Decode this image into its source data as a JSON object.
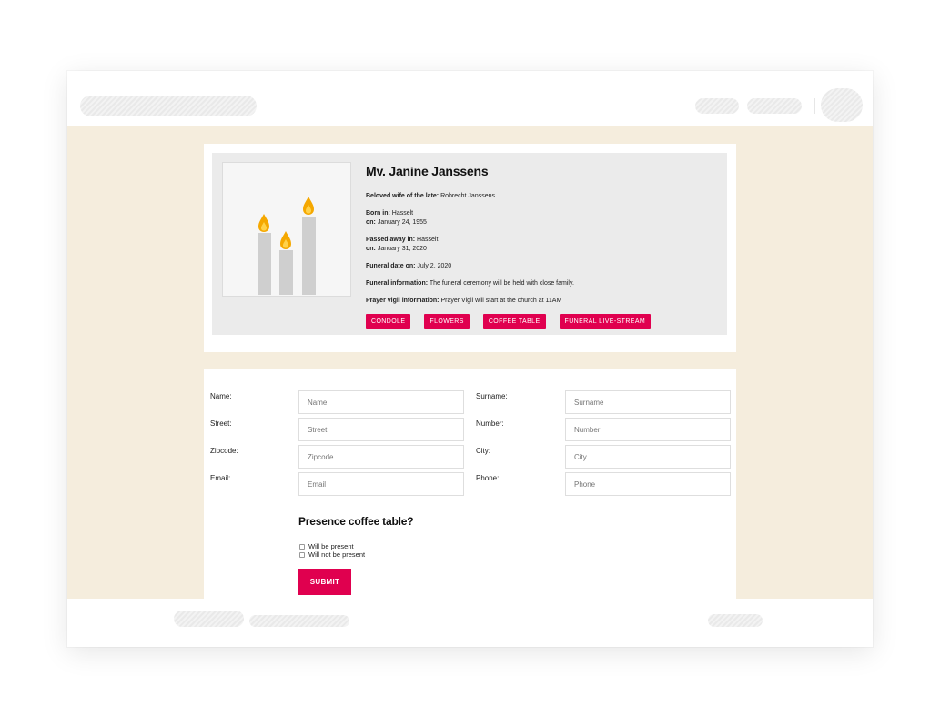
{
  "deceased": {
    "name": "Mv. Janine Janssens",
    "details": [
      {
        "label": "Beloved wife of the late:",
        "value": "Robrecht Janssens"
      },
      {
        "label": "Born in:",
        "value": "Hasselt"
      },
      {
        "label": "on:",
        "value": "January 24, 1955"
      },
      {
        "label": "Passed away in:",
        "value": "Hasselt"
      },
      {
        "label": "on:",
        "value": "January 31, 2020"
      },
      {
        "label": "Funeral date on:",
        "value": "July 2, 2020"
      },
      {
        "label": "Funeral information:",
        "value": "The funeral ceremony will be held with close family."
      },
      {
        "label": "Prayer vigil information:",
        "value": "Prayer Vigil will start at the church at 11AM"
      }
    ],
    "buttons": [
      "CONDOLE",
      "FLOWERS",
      "COFFEE TABLE",
      "FUNERAL LIVE-STREAM"
    ]
  },
  "form": {
    "fields": [
      {
        "label": "Name:",
        "placeholder": "Name"
      },
      {
        "label": "Surname:",
        "placeholder": "Surname"
      },
      {
        "label": "Street:",
        "placeholder": "Street"
      },
      {
        "label": "Number:",
        "placeholder": "Number"
      },
      {
        "label": "Zipcode:",
        "placeholder": "Zipcode"
      },
      {
        "label": "City:",
        "placeholder": "City"
      },
      {
        "label": "Email:",
        "placeholder": "Email"
      },
      {
        "label": "Phone:",
        "placeholder": "Phone"
      }
    ],
    "question": "Presence coffee table?",
    "options": [
      "Will be present",
      "Will not be present"
    ],
    "submit_label": "SUBMIT"
  },
  "colors": {
    "accent": "#e0004f",
    "page_background": "#f5eddd",
    "info_panel": "#ebebeb",
    "flame": "#f5a800"
  },
  "icons": [
    "candles-illustration"
  ]
}
